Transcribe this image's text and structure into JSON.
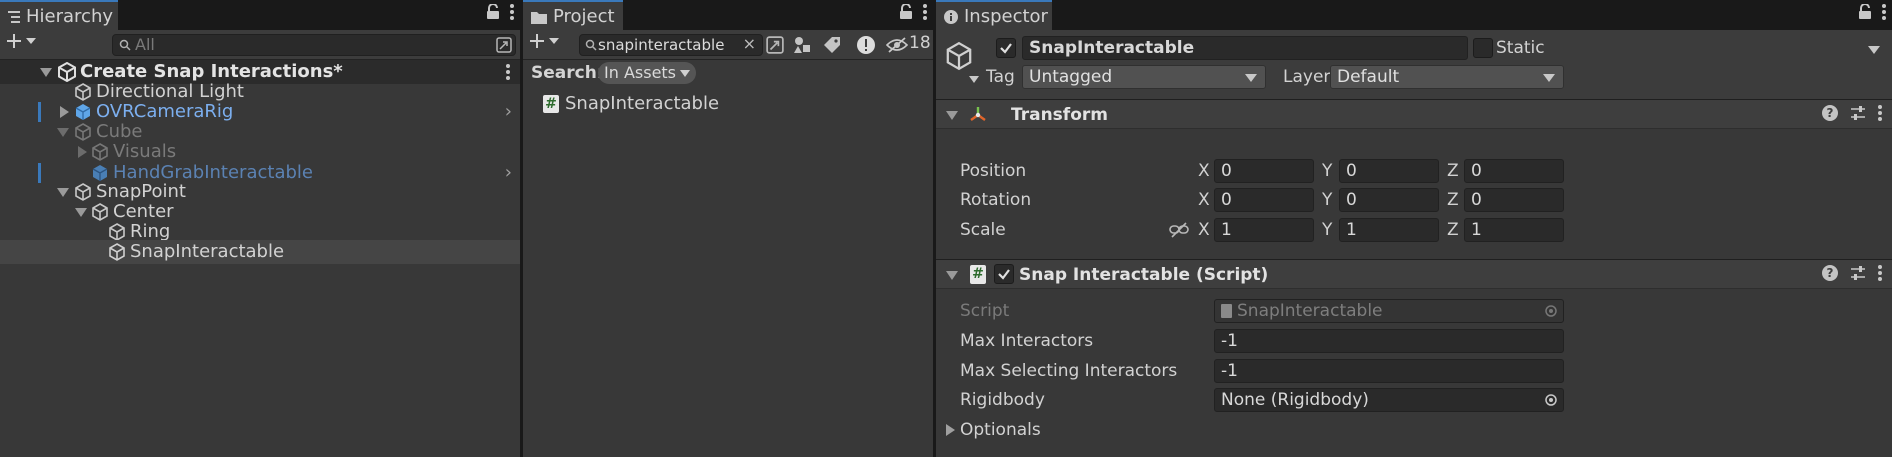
{
  "hierarchy": {
    "tab_title": "Hierarchy",
    "search_placeholder": "All",
    "scene_name": "Create Snap Interactions*",
    "items": [
      {
        "label": "Directional Light"
      },
      {
        "label": "OVRCameraRig"
      },
      {
        "label": "Cube"
      },
      {
        "label": "Visuals"
      },
      {
        "label": "HandGrabInteractable"
      },
      {
        "label": "SnapPoint"
      },
      {
        "label": "Center"
      },
      {
        "label": "Ring"
      },
      {
        "label": "SnapInteractable"
      }
    ]
  },
  "project": {
    "tab_title": "Project",
    "search_value": "snapinteractable",
    "hidden_count": "18",
    "search_label": "Search:",
    "search_scope": "In Assets",
    "results": [
      {
        "label": "SnapInteractable",
        "icon": "hash-script-icon"
      }
    ]
  },
  "inspector": {
    "tab_title": "Inspector",
    "object_name": "SnapInteractable",
    "static_label": "Static",
    "tag_label": "Tag",
    "tag_value": "Untagged",
    "layer_label": "Layer",
    "layer_value": "Default",
    "transform": {
      "title": "Transform",
      "position_label": "Position",
      "rotation_label": "Rotation",
      "scale_label": "Scale",
      "x": "X",
      "y": "Y",
      "z": "Z",
      "position": [
        "0",
        "0",
        "0"
      ],
      "rotation": [
        "0",
        "0",
        "0"
      ],
      "scale": [
        "1",
        "1",
        "1"
      ]
    },
    "script_component": {
      "title": "Snap Interactable (Script)",
      "script_label": "Script",
      "script_value": "SnapInteractable",
      "max_interactors_label": "Max Interactors",
      "max_interactors_value": "-1",
      "max_selecting_label": "Max Selecting Interactors",
      "max_selecting_value": "-1",
      "rigidbody_label": "Rigidbody",
      "rigidbody_value": "None (Rigidbody)",
      "optionals_label": "Optionals"
    }
  },
  "colors": {
    "accent": "#3a79bb",
    "prefab_blue": "#7cafef",
    "panel_bg": "#383838",
    "field_bg": "#2a2a2a"
  }
}
